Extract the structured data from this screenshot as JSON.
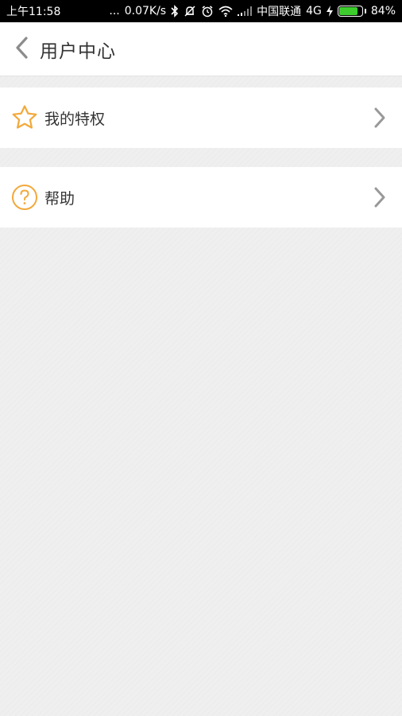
{
  "status_bar": {
    "time": "上午11:58",
    "dots": "...",
    "speed": "0.07K/s",
    "carrier": "中国联通",
    "network": "4G",
    "battery_percent": "84%",
    "battery_level": 0.84,
    "icons": [
      "bluetooth-icon",
      "mute-icon",
      "alarm-icon",
      "wifi-icon",
      "signal-icon",
      "charging-icon",
      "battery-icon"
    ]
  },
  "header": {
    "title": "用户中心",
    "back_icon": "chevron-left-icon"
  },
  "menu": {
    "items": [
      {
        "label": "我的特权",
        "icon": "star-icon"
      },
      {
        "label": "帮助",
        "icon": "help-icon"
      }
    ]
  },
  "colors": {
    "accent": "#f2a93b",
    "chevron": "#999999",
    "text": "#333333",
    "background": "#efefef",
    "battery": "#3ccd2d"
  }
}
